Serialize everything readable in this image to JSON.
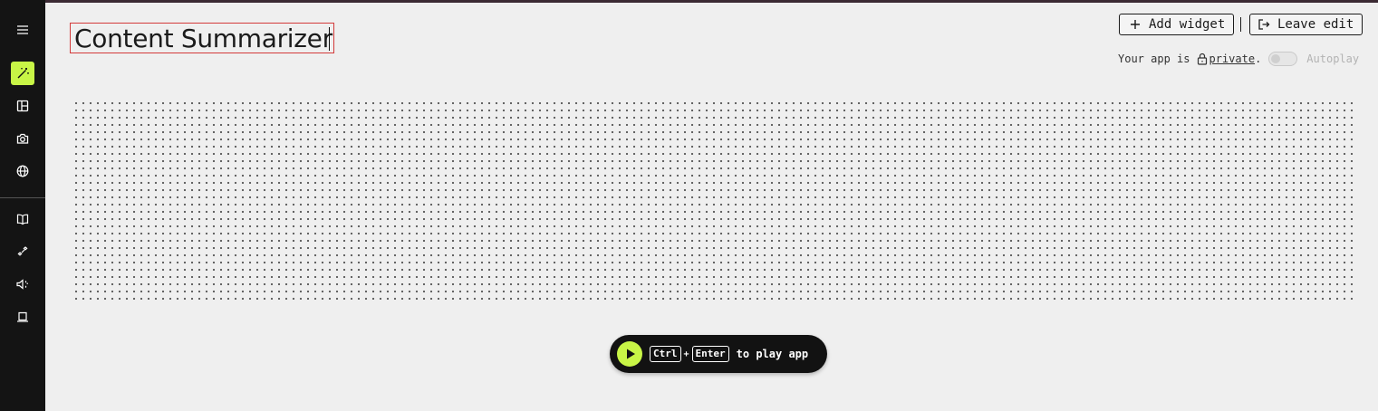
{
  "app": {
    "title": "Content Summarizer"
  },
  "toolbar": {
    "add_widget_label": "Add widget",
    "leave_edit_label": "Leave edit"
  },
  "status": {
    "prefix": "Your app is",
    "privacy_link": "private",
    "suffix": ".",
    "autoplay_label": "Autoplay",
    "autoplay_on": false
  },
  "play_hint": {
    "key1": "Ctrl",
    "plus": "+",
    "key2": "Enter",
    "text": "to play app"
  },
  "sidebar": {
    "items": [
      {
        "icon": "menu-icon"
      },
      {
        "icon": "magic-wand-icon",
        "active": true
      },
      {
        "icon": "layout-icon"
      },
      {
        "icon": "camera-icon"
      },
      {
        "icon": "globe-icon"
      },
      {
        "icon": "book-icon"
      },
      {
        "icon": "sparkles-icon"
      },
      {
        "icon": "speaker-icon"
      },
      {
        "icon": "laptop-icon"
      }
    ]
  },
  "colors": {
    "accent": "#c8f546",
    "sidebar_bg": "#141414",
    "canvas_bg": "#efefef",
    "title_border": "#d33a3a"
  }
}
